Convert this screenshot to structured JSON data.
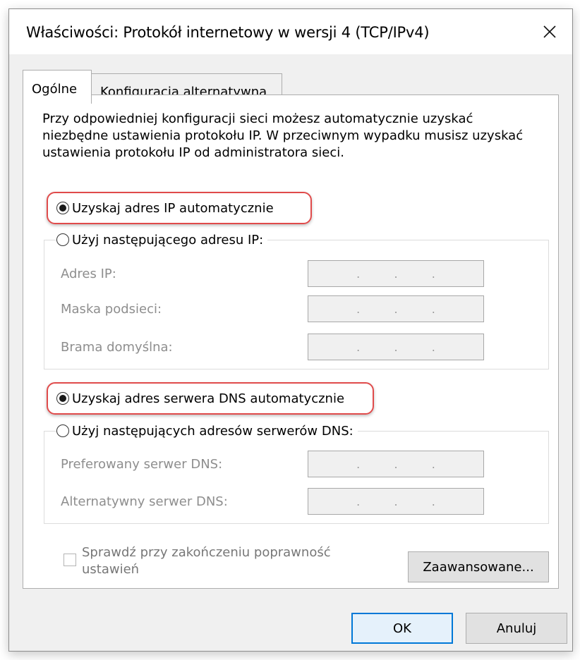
{
  "dialog": {
    "title": "Właściwości: Protokół internetowy w wersji 4 (TCP/IPv4)",
    "close_icon": "close-icon"
  },
  "tabs": [
    {
      "label": "Ogólne",
      "active": true
    },
    {
      "label": "Konfiguracja alternatywna",
      "active": false
    }
  ],
  "intro_text": "Przy odpowiedniej konfiguracji sieci możesz automatycznie uzyskać niezbędne ustawienia protokołu IP. W przeciwnym wypadku musisz uzyskać ustawienia protokołu IP od administratora sieci.",
  "ip_section": {
    "auto_label": "Uzyskaj adres IP automatycznie",
    "auto_selected": true,
    "manual_label": "Użyj następującego adresu IP:",
    "fields": [
      {
        "label": "Adres IP:",
        "value": ". . ."
      },
      {
        "label": "Maska podsieci:",
        "value": ". . ."
      },
      {
        "label": "Brama domyślna:",
        "value": ". . ."
      }
    ]
  },
  "dns_section": {
    "auto_label": "Uzyskaj adres serwera DNS automatycznie",
    "auto_selected": true,
    "manual_label": "Użyj następujących adresów serwerów DNS:",
    "fields": [
      {
        "label": "Preferowany serwer DNS:",
        "value": ". . ."
      },
      {
        "label": "Alternatywny serwer DNS:",
        "value": ". . ."
      }
    ]
  },
  "validate_checkbox": {
    "label": "Sprawdź przy zakończeniu poprawność ustawień",
    "checked": false
  },
  "buttons": {
    "advanced": "Zaawansowane...",
    "ok": "OK",
    "cancel": "Anuluj"
  },
  "colors": {
    "highlight": "#e04b4b",
    "default_button_border": "#0078d7"
  }
}
